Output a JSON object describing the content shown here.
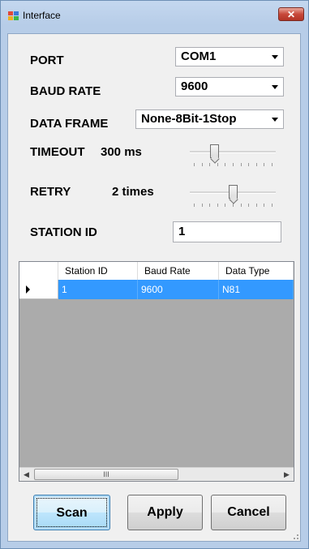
{
  "window": {
    "title": "Interface",
    "close_label": "✕"
  },
  "form": {
    "port_label": "PORT",
    "port_value": "COM1",
    "baud_label": "BAUD RATE",
    "baud_value": "9600",
    "frame_label": "DATA FRAME",
    "frame_value": "None-8Bit-1Stop",
    "timeout_label": "TIMEOUT",
    "timeout_value": "300 ms",
    "timeout_level": 0.26,
    "retry_label": "RETRY",
    "retry_value": "2 times",
    "retry_level": 0.5,
    "station_label": "STATION ID",
    "station_value": "1"
  },
  "grid": {
    "columns": [
      "Station ID",
      "Baud Rate",
      "Data Type"
    ],
    "rows": [
      {
        "station": "1",
        "baud": "9600",
        "type": "N81"
      }
    ],
    "scroll_thumb_label": "III"
  },
  "buttons": {
    "scan": "Scan",
    "apply": "Apply",
    "cancel": "Cancel"
  }
}
